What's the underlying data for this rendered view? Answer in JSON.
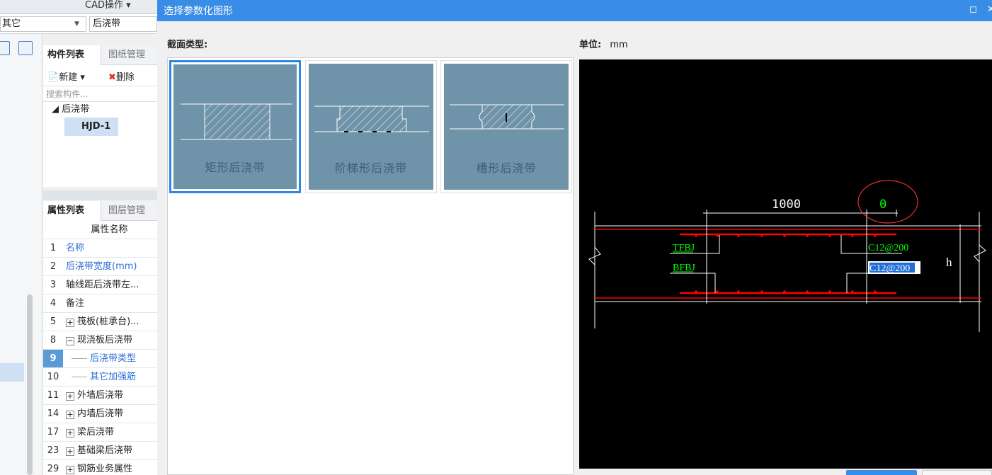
{
  "background_app": {
    "cad_menu": "CAD操作",
    "type_combo": "其它",
    "element_combo": "后浇带",
    "component_tabs": [
      "构件列表",
      "图纸管理"
    ],
    "toolbar": {
      "new_label": "新建",
      "delete_label": "删除"
    },
    "search_placeholder": "搜索构件...",
    "tree": {
      "root": "后浇带",
      "child": "HJD-1"
    },
    "property_tabs": [
      "属性列表",
      "图层管理"
    ],
    "property_header": "属性名称",
    "properties": [
      {
        "n": "1",
        "name": "名称"
      },
      {
        "n": "2",
        "name": "后浇带宽度(mm)"
      },
      {
        "n": "3",
        "name": "轴线距后浇带左..."
      },
      {
        "n": "4",
        "name": "备注"
      },
      {
        "n": "5",
        "name": "筏板(桩承台)..."
      },
      {
        "n": "8",
        "name": "现浇板后浇带"
      },
      {
        "n": "9",
        "name": "后浇带类型"
      },
      {
        "n": "10",
        "name": "其它加强筋"
      },
      {
        "n": "11",
        "name": "外墙后浇带"
      },
      {
        "n": "14",
        "name": "内墙后浇带"
      },
      {
        "n": "17",
        "name": "梁后浇带"
      },
      {
        "n": "23",
        "name": "基础梁后浇带"
      },
      {
        "n": "29",
        "name": "钢筋业务属性"
      }
    ]
  },
  "dialog": {
    "title": "选择参数化图形",
    "section_label": "截面类型:",
    "unit_label": "单位:",
    "unit_value": "mm",
    "shapes": [
      {
        "name": "矩形后浇带",
        "selected": true
      },
      {
        "name": "阶梯形后浇带",
        "selected": false
      },
      {
        "name": "槽形后浇带",
        "selected": false
      }
    ],
    "preview": {
      "dim_width": "1000",
      "dim_offset": "0",
      "top_rebar_label": "TFBJ",
      "bottom_rebar_label": "BFBJ",
      "top_rebar_value": "C12@200",
      "bottom_rebar_value": "C12@200",
      "height_label": "h"
    }
  },
  "colors": {
    "accent": "#3a8de6",
    "tile": "#6f93a8",
    "rebar": "#ff0000",
    "cad_text": "#00ff00"
  }
}
